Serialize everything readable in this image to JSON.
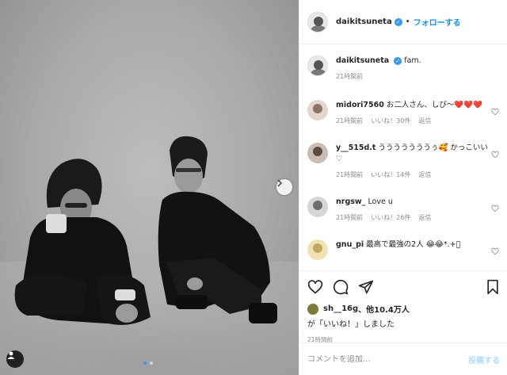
{
  "post": {
    "header": {
      "username": "daikitsuneta",
      "separator": "•",
      "follow_label": "フォローする"
    },
    "caption": {
      "username": "daikitsuneta",
      "text": "fam.",
      "time": "21時間前"
    },
    "comments": [
      {
        "username": "midori7560",
        "text": "お二人さん、しび〜❤️❤️❤️",
        "time": "21時間前",
        "likes": "いいね！30件",
        "reply": "返信",
        "avatar_color": "#b7a39a"
      },
      {
        "username": "y__515d.t",
        "text": "うううううううぅ🥰 かっこいい♡",
        "time": "21時間前",
        "likes": "いいね！14件",
        "reply": "返信",
        "avatar_color": "#8a7d76"
      },
      {
        "username": "nrgsw_",
        "text": "Love u",
        "time": "21時間前",
        "likes": "いいね！26件",
        "reply": "返信",
        "avatar_color": "#9c9c9c"
      },
      {
        "username": "gnu_pi",
        "text": "最高で最強の2人 😂😂*.+゚",
        "time": "",
        "likes": "",
        "reply": "",
        "avatar_color": "#d8c68a"
      }
    ],
    "actions": {
      "liked_by_user": "sh__16g",
      "likes_text": "、他10.4万人",
      "likes_line2": "が「いいね！」しました",
      "timestamp": "21時間前"
    },
    "add_comment": {
      "placeholder": "コメントを追加...",
      "post_label": "投稿する"
    },
    "carousel": {
      "total": 2,
      "current": 1
    }
  },
  "colors": {
    "accent": "#0095f6",
    "verified": "#3897f0",
    "meta": "#8e8e8e",
    "text": "#262626"
  },
  "icons": [
    "heart-icon",
    "comment-icon",
    "share-icon",
    "bookmark-icon",
    "chevron-right-icon",
    "user-tag-icon",
    "verified-icon"
  ]
}
